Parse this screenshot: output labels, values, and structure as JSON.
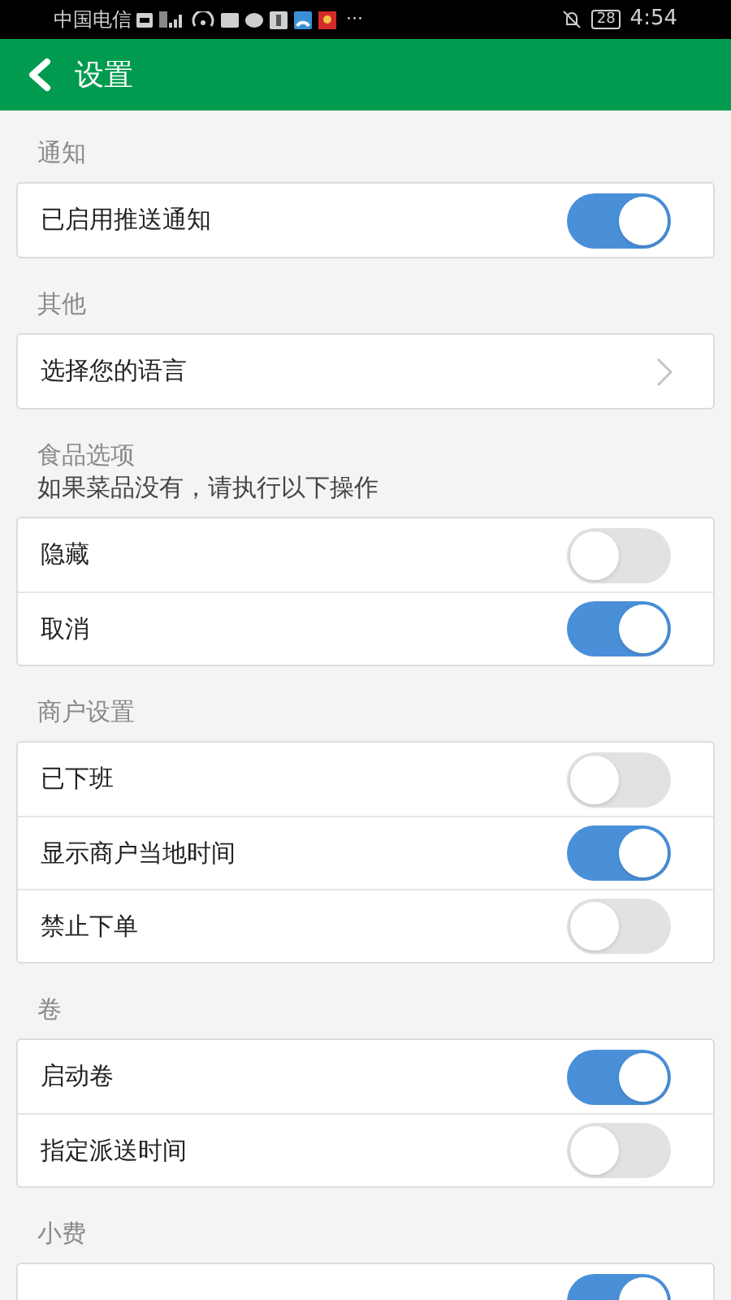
{
  "status_bar": {
    "carrier": "中国电信",
    "battery": "28",
    "time": "4:54",
    "more": "···"
  },
  "header": {
    "title": "设置"
  },
  "sections": [
    {
      "title": "通知",
      "rows": [
        {
          "kind": "toggle",
          "label": "已启用推送通知",
          "on": true
        }
      ]
    },
    {
      "title": "其他",
      "rows": [
        {
          "kind": "link",
          "label": "选择您的语言"
        }
      ]
    },
    {
      "title": "食品选项",
      "subtitle": "如果菜品没有，请执行以下操作",
      "rows": [
        {
          "kind": "toggle",
          "label": "隐藏",
          "on": false
        },
        {
          "kind": "toggle",
          "label": "取消",
          "on": true
        }
      ]
    },
    {
      "title": "商户设置",
      "rows": [
        {
          "kind": "toggle",
          "label": "已下班",
          "on": false
        },
        {
          "kind": "toggle",
          "label": "显示商户当地时间",
          "on": true
        },
        {
          "kind": "toggle",
          "label": "禁止下单",
          "on": false
        }
      ]
    },
    {
      "title": "卷",
      "rows": [
        {
          "kind": "toggle",
          "label": "启动卷",
          "on": true
        },
        {
          "kind": "toggle",
          "label": "指定派送时间",
          "on": false
        }
      ]
    },
    {
      "title": "小费",
      "rows": [
        {
          "kind": "toggle",
          "on": true
        }
      ]
    }
  ]
}
